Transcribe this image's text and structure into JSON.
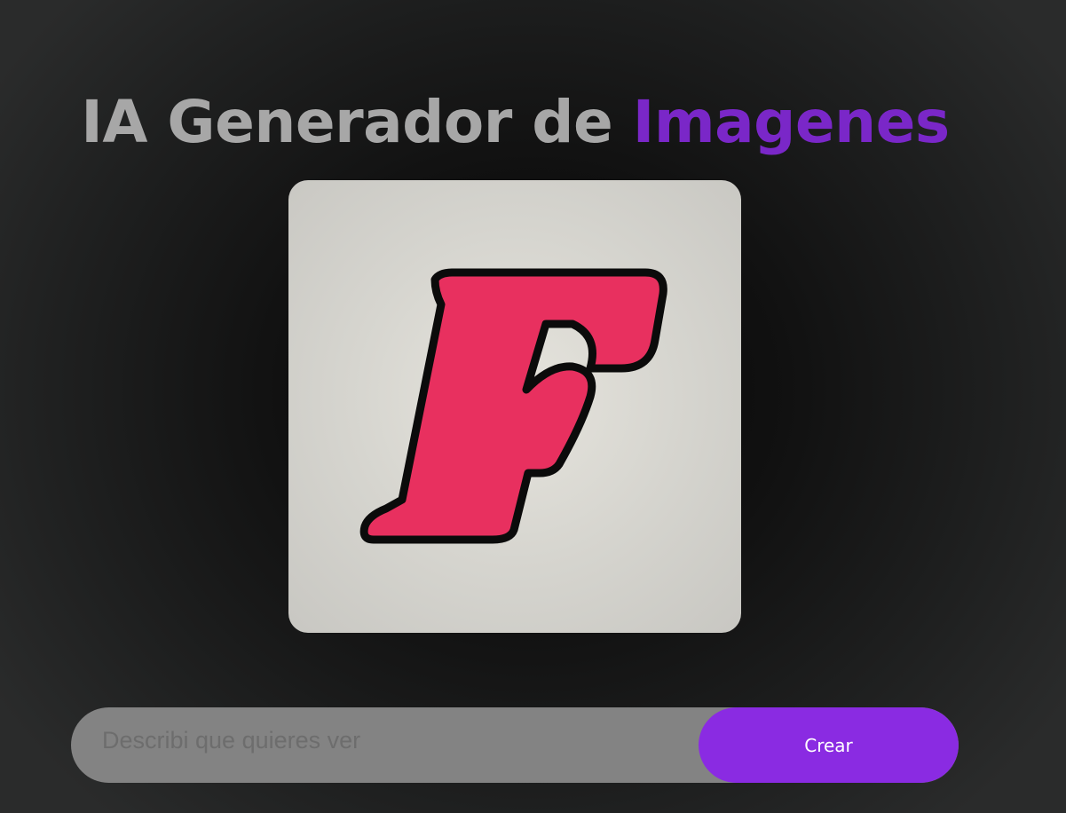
{
  "header": {
    "title_main": "IA Generador de ",
    "title_accent": "Imagenes"
  },
  "generated_image": {
    "content": "letter-f-logo",
    "letter": "F",
    "letter_color": "#e8305f"
  },
  "prompt": {
    "placeholder": "Describi que quieres ver",
    "value": ""
  },
  "actions": {
    "create_label": "Crear"
  },
  "colors": {
    "accent": "#8a2be2",
    "title_accent": "#7a27c8",
    "title_gray": "#a7a7a7",
    "input_background": "#838383"
  }
}
